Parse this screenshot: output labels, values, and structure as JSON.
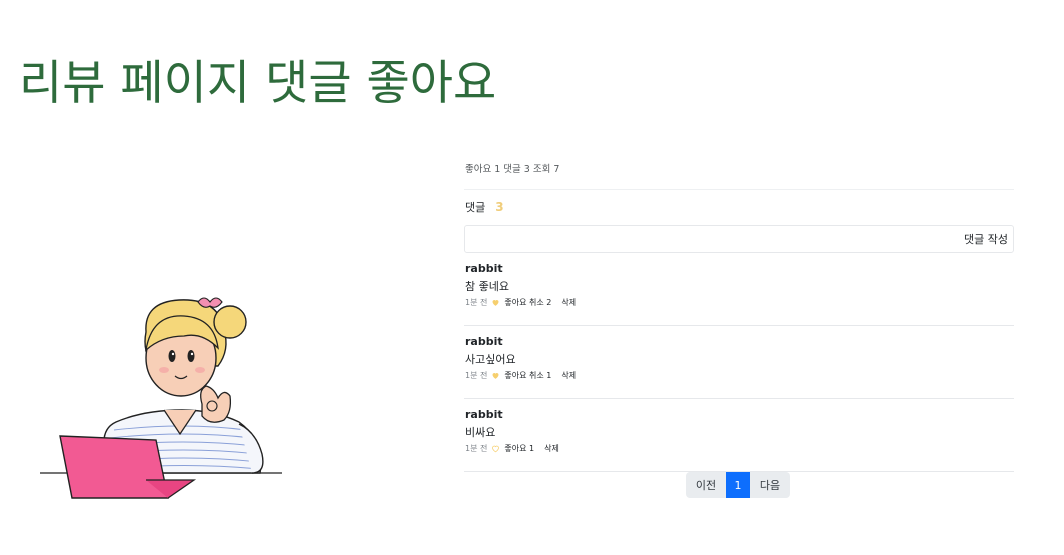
{
  "title": "리뷰 페이지 댓글 좋아요",
  "stats": "좋아요 1 댓글 3 조회 7",
  "comments_section": {
    "label": "댓글",
    "count": "3",
    "write_button": "댓글 작성"
  },
  "comments": [
    {
      "user": "rabbit",
      "text": "참 좋네요",
      "time": "1분 전",
      "like_label": "좋아요 취소 2",
      "liked": true,
      "delete_label": "삭제"
    },
    {
      "user": "rabbit",
      "text": "사고싶어요",
      "time": "1분 전",
      "like_label": "좋아요 취소 1",
      "liked": true,
      "delete_label": "삭제"
    },
    {
      "user": "rabbit",
      "text": "비싸요",
      "time": "1분 전",
      "like_label": "좋아요 1",
      "liked": false,
      "delete_label": "삭제"
    }
  ],
  "pagination": {
    "prev": "이전",
    "current": "1",
    "next": "다음"
  },
  "colors": {
    "title": "#2e6b3c",
    "accent": "#0d6efd",
    "count": "#f0cd7a",
    "heart": "#f6cf6e"
  }
}
